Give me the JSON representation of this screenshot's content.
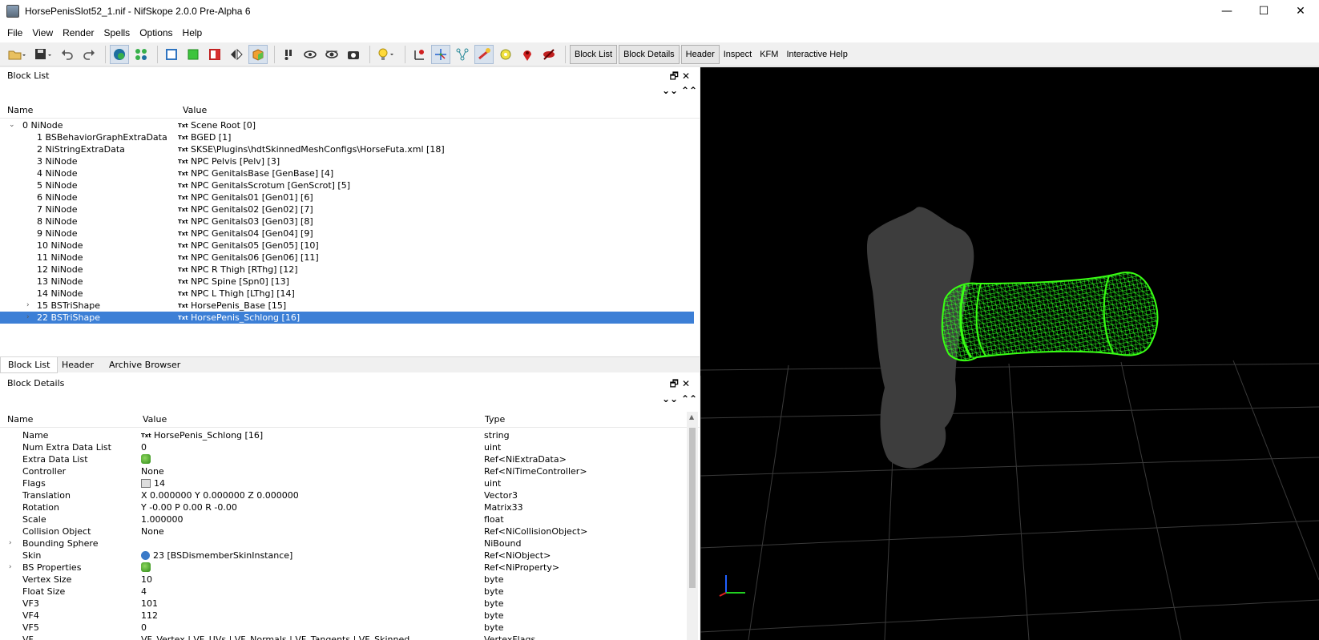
{
  "window": {
    "title": "HorsePenisSlot52_1.nif - NifSkope 2.0.0 Pre-Alpha 6",
    "minimize": "—",
    "maximize": "☐",
    "close": "✕"
  },
  "menu": [
    "File",
    "View",
    "Render",
    "Spells",
    "Options",
    "Help"
  ],
  "toolbar": {
    "text_buttons": [
      "Block List",
      "Block Details",
      "Header",
      "Inspect",
      "KFM",
      "Interactive Help"
    ]
  },
  "block_list": {
    "title": "Block List",
    "col_name": "Name",
    "col_value": "Value",
    "txt_tag": "Txt",
    "rows": [
      {
        "name": "0 NiNode",
        "value": "Scene Root [0]"
      },
      {
        "name": "1 BSBehaviorGraphExtraData",
        "value": "BGED [1]"
      },
      {
        "name": "2 NiStringExtraData",
        "value": "SKSE\\Plugins\\hdtSkinnedMeshConfigs\\HorseFuta.xml [18]"
      },
      {
        "name": "3 NiNode",
        "value": "NPC Pelvis [Pelv] [3]"
      },
      {
        "name": "4 NiNode",
        "value": "NPC GenitalsBase [GenBase] [4]"
      },
      {
        "name": "5 NiNode",
        "value": "NPC GenitalsScrotum [GenScrot] [5]"
      },
      {
        "name": "6 NiNode",
        "value": "NPC Genitals01 [Gen01] [6]"
      },
      {
        "name": "7 NiNode",
        "value": "NPC Genitals02 [Gen02] [7]"
      },
      {
        "name": "8 NiNode",
        "value": "NPC Genitals03 [Gen03] [8]"
      },
      {
        "name": "9 NiNode",
        "value": "NPC Genitals04 [Gen04] [9]"
      },
      {
        "name": "10 NiNode",
        "value": "NPC Genitals05 [Gen05] [10]"
      },
      {
        "name": "11 NiNode",
        "value": "NPC Genitals06 [Gen06] [11]"
      },
      {
        "name": "12 NiNode",
        "value": "NPC R Thigh [RThg] [12]"
      },
      {
        "name": "13 NiNode",
        "value": "NPC Spine [Spn0] [13]"
      },
      {
        "name": "14 NiNode",
        "value": "NPC L Thigh [LThg] [14]"
      },
      {
        "name": "15 BSTriShape",
        "value": "HorsePenis_Base [15]"
      },
      {
        "name": "22 BSTriShape",
        "value": "HorsePenis_Schlong [16]"
      }
    ]
  },
  "tabs": [
    "Block List",
    "Header",
    "Archive Browser"
  ],
  "block_details": {
    "title": "Block Details",
    "col_name": "Name",
    "col_value": "Value",
    "col_type": "Type",
    "txt_tag": "Txt",
    "rows": [
      {
        "name": "Name",
        "value": "HorsePenis_Schlong [16]",
        "type": "string"
      },
      {
        "name": "Num Extra Data List",
        "value": "0",
        "type": "uint"
      },
      {
        "name": "Extra Data List",
        "value": "",
        "type": "Ref<NiExtraData>"
      },
      {
        "name": "Controller",
        "value": "None",
        "type": "Ref<NiTimeController>"
      },
      {
        "name": "Flags",
        "value": "14",
        "type": "uint"
      },
      {
        "name": "Translation",
        "value": "X 0.000000 Y 0.000000 Z 0.000000",
        "type": "Vector3"
      },
      {
        "name": "Rotation",
        "value": "Y -0.00 P 0.00 R -0.00",
        "type": "Matrix33"
      },
      {
        "name": "Scale",
        "value": "1.000000",
        "type": "float"
      },
      {
        "name": "Collision Object",
        "value": "None",
        "type": "Ref<NiCollisionObject>"
      },
      {
        "name": "Bounding Sphere",
        "value": "",
        "type": "NiBound"
      },
      {
        "name": "Skin",
        "value": "23 [BSDismemberSkinInstance]",
        "type": "Ref<NiObject>"
      },
      {
        "name": "BS Properties",
        "value": "",
        "type": "Ref<NiProperty>"
      },
      {
        "name": "Vertex Size",
        "value": "10",
        "type": "byte"
      },
      {
        "name": "Float Size",
        "value": "4",
        "type": "byte"
      },
      {
        "name": "VF3",
        "value": "101",
        "type": "byte"
      },
      {
        "name": "VF4",
        "value": "112",
        "type": "byte"
      },
      {
        "name": "VF5",
        "value": "0",
        "type": "byte"
      },
      {
        "name": "VF",
        "value": "VF_Vertex | VF_UVs | VF_Normals | VF_Tangents | VF_Skinned",
        "type": "VertexFlags"
      }
    ]
  },
  "colors": {
    "selection": "#3c7fd6",
    "viewport_bg": "#000000",
    "wireframe": "#39ff14",
    "mesh_gray": "#3d3d3d"
  }
}
